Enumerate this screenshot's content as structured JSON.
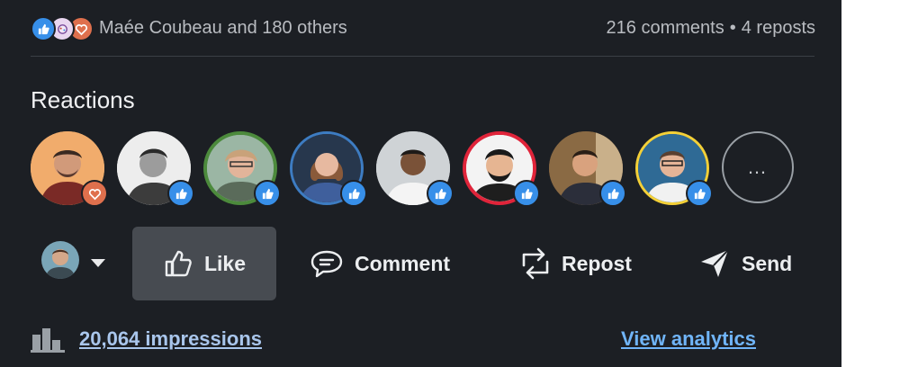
{
  "social": {
    "reactors_text": "Maée Coubeau and 180 others",
    "comments": "216 comments",
    "separator": "•",
    "reposts": "4 reposts",
    "reaction_icons": [
      "like-icon",
      "celebrate-icon",
      "love-icon"
    ]
  },
  "reactions": {
    "title": "Reactions",
    "more_label": "…",
    "people": [
      {
        "reaction": "love",
        "ring": "#1c1f24"
      },
      {
        "reaction": "like",
        "ring": "#1c1f24"
      },
      {
        "reaction": "like",
        "ring": "#4c8a3c"
      },
      {
        "reaction": "like",
        "ring": "#3d7cc2"
      },
      {
        "reaction": "like",
        "ring": "#1c1f24"
      },
      {
        "reaction": "like",
        "ring": "#e0243a"
      },
      {
        "reaction": "like",
        "ring": "#1c1f24"
      },
      {
        "reaction": "like",
        "ring": "#f4d037"
      }
    ]
  },
  "actions": {
    "like": "Like",
    "comment": "Comment",
    "repost": "Repost",
    "send": "Send"
  },
  "footer": {
    "impressions": "20,064 impressions",
    "analytics": "View analytics"
  },
  "colors": {
    "background": "#1c1f24",
    "like_blue": "#378fe9",
    "love_orange": "#df704d",
    "link_blue": "#70b5f9"
  }
}
